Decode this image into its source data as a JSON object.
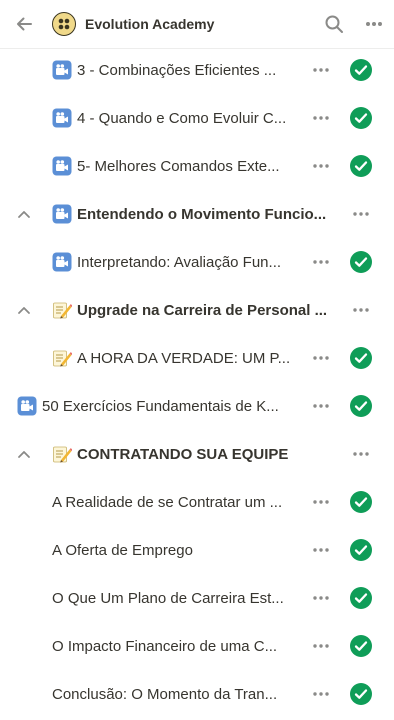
{
  "header": {
    "title": "Evolution Academy",
    "icons": [
      "back-arrow-icon",
      "logo-icon",
      "search-icon",
      "more-icon"
    ]
  },
  "rows": [
    {
      "label": "3 - Combinações Eficientes ...",
      "emoji": "video-camera-icon",
      "done": true
    },
    {
      "label": "4 - Quando e Como Evoluir C...",
      "emoji": "video-camera-icon",
      "done": true
    },
    {
      "label": "5- Melhores Comandos Exte...",
      "emoji": "video-camera-icon",
      "done": true
    },
    {
      "label": "Entendendo o Movimento Funcio...",
      "emoji": "video-camera-icon",
      "section": true
    },
    {
      "label": "Interpretando: Avaliação Fun...",
      "emoji": "video-camera-icon",
      "done": true
    },
    {
      "label": "Upgrade na Carreira de Personal ...",
      "emoji": "memo-icon",
      "section": true
    },
    {
      "label": "A HORA DA VERDADE: UM P...",
      "emoji": "memo-icon",
      "done": true
    },
    {
      "label": "50 Exercícios Fundamentais de K...",
      "emoji": "video-camera-icon",
      "done": true
    },
    {
      "label": "CONTRATANDO SUA EQUIPE",
      "emoji": "memo-icon",
      "section": true
    },
    {
      "label": "A Realidade de se Contratar um ...",
      "done": true
    },
    {
      "label": "A Oferta de Emprego",
      "done": true
    },
    {
      "label": "O Que Um Plano de Carreira Est...",
      "done": true
    },
    {
      "label": "O Impacto Financeiro de uma C...",
      "done": true
    },
    {
      "label": "Conclusão: O Momento da Tran...",
      "done": true
    }
  ],
  "colors": {
    "check": "#0f9d58",
    "text": "#37352f",
    "icon": "#8a8a88"
  }
}
